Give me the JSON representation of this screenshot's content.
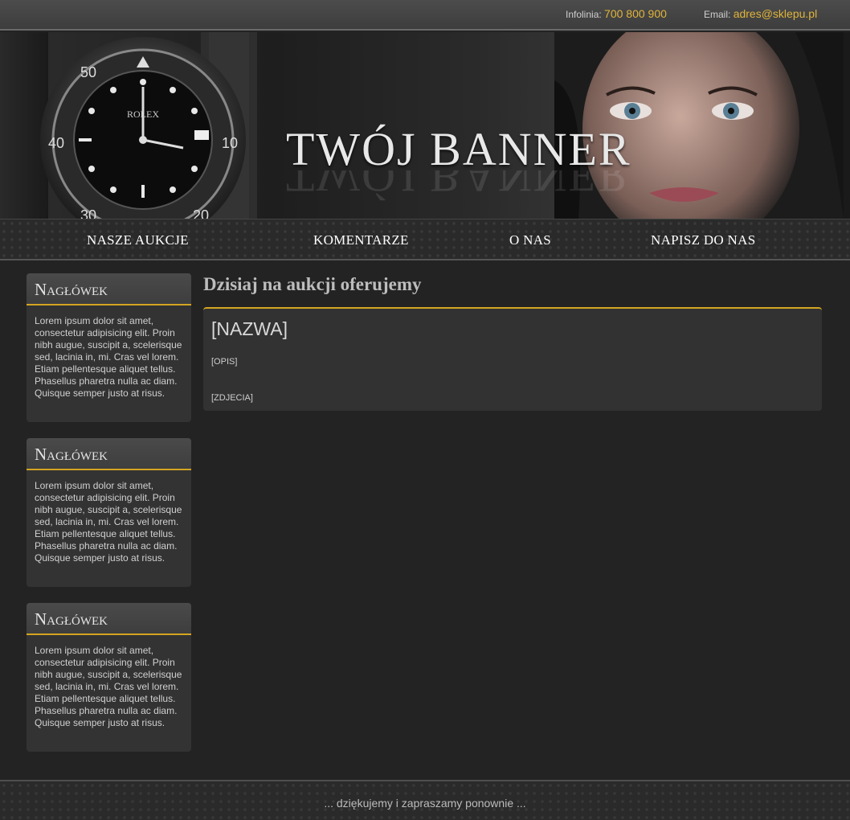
{
  "topbar": {
    "phone_label": "Infolinia:",
    "phone_value": "700 800 900",
    "email_label": "Email:",
    "email_value": "adres@sklepu.pl"
  },
  "banner": {
    "title": "TWÓJ BANNER"
  },
  "nav": {
    "items": [
      {
        "label": "NASZE AUKCJE"
      },
      {
        "label": "KOMENTARZE"
      },
      {
        "label": "O NAS"
      },
      {
        "label": "NAPISZ DO NAS"
      }
    ]
  },
  "sidebar": {
    "boxes": [
      {
        "heading": "Nagłówek",
        "text": "Lorem ipsum dolor sit amet, consectetur adipisicing elit. Proin nibh augue, suscipit a, scelerisque sed, lacinia in, mi. Cras vel lorem. Etiam pellentesque aliquet tellus. Phasellus pharetra nulla ac diam. Quisque semper justo at risus."
      },
      {
        "heading": "Nagłówek",
        "text": "Lorem ipsum dolor sit amet, consectetur adipisicing elit. Proin nibh augue, suscipit a, scelerisque sed, lacinia in, mi. Cras vel lorem. Etiam pellentesque aliquet tellus. Phasellus pharetra nulla ac diam. Quisque semper justo at risus."
      },
      {
        "heading": "Nagłówek",
        "text": "Lorem ipsum dolor sit amet, consectetur adipisicing elit. Proin nibh augue, suscipit a, scelerisque sed, lacinia in, mi. Cras vel lorem. Etiam pellentesque aliquet tellus. Phasellus pharetra nulla ac diam. Quisque semper justo at risus."
      }
    ]
  },
  "main": {
    "title": "Dzisiaj na aukcji oferujemy",
    "auction": {
      "name": "[NAZWA]",
      "description": "[OPIS]",
      "photos": "[ZDJECIA]"
    }
  },
  "footer": {
    "text": "... dziękujemy i zapraszamy ponownie ..."
  },
  "colors": {
    "accent": "#d4a520",
    "background": "#232323",
    "panel": "#333333"
  }
}
